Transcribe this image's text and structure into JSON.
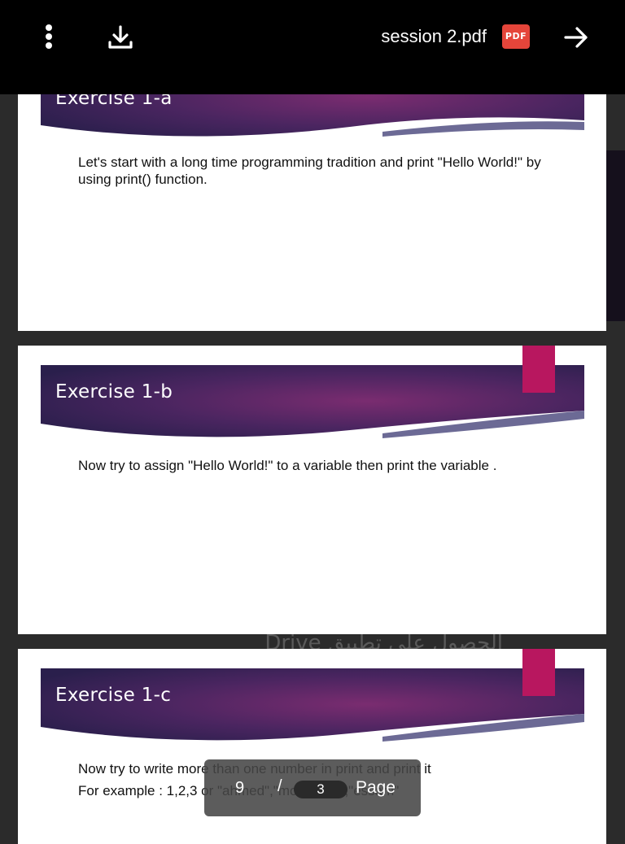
{
  "topbar": {
    "title": "session 2.pdf",
    "pdf_badge": "PDF",
    "icons": [
      "more-vert-icon",
      "download-icon",
      "arrow-right-icon"
    ]
  },
  "background": {
    "partial_text": "الحصول على تطبيق Drive"
  },
  "slides": [
    {
      "title": "Exercise 1-a",
      "body": [
        "Let's start with a long time programming tradition and print \"Hello World!\" by using print() function."
      ]
    },
    {
      "title": "Exercise 1-b",
      "body": [
        "Now try to assign \"Hello World!\" to a variable then print the variable ."
      ]
    },
    {
      "title": "Exercise 1-c",
      "body": [
        "Now try to write more than one number in print and print it",
        "For example : 1,2,3 or \"ahmed\",\"mohamed\",\"essam\""
      ]
    }
  ],
  "page_indicator": {
    "current": "9",
    "separator": "/",
    "total": "3",
    "label": "Page"
  },
  "colors": {
    "banner_dark": "#2e1f4f",
    "banner_mid": "#6e2a6a",
    "accent_tab": "#b8175f",
    "pdf_badge": "#e5453a"
  }
}
